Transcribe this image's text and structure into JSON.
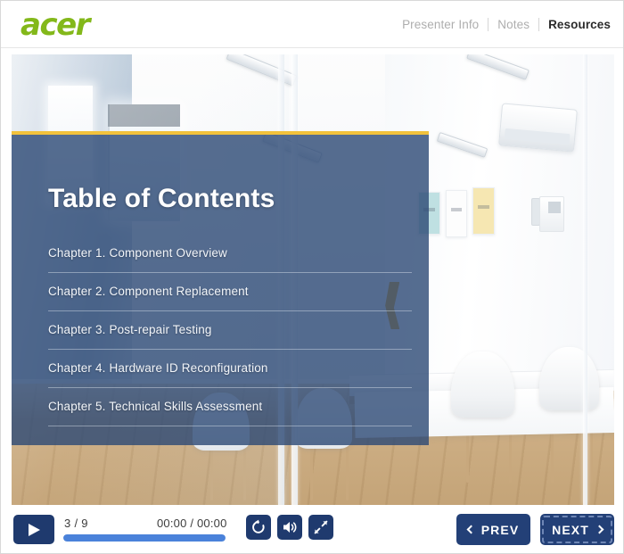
{
  "header": {
    "logo_text": "acer",
    "logo_color": "#83b81a",
    "nav": [
      {
        "label": "Presenter Info",
        "active": false
      },
      {
        "label": "Notes",
        "active": false
      },
      {
        "label": "Resources",
        "active": true
      }
    ]
  },
  "slide": {
    "title": "Table of Contents",
    "accent_bar_color": "#f2c23c",
    "panel_color": "#2c4874",
    "toc": [
      {
        "label": "Chapter 1. Component Overview"
      },
      {
        "label": "Chapter 2. Component Replacement"
      },
      {
        "label": "Chapter 3. Post-repair Testing"
      },
      {
        "label": "Chapter 4. Hardware ID Reconfiguration"
      },
      {
        "label": "Chapter 5. Technical Skills Assessment"
      }
    ]
  },
  "controls": {
    "play_label": "play-button",
    "slide_count": "3 / 9",
    "current_slide": 3,
    "total_slides": 9,
    "time_display": "00:00 / 00:00",
    "elapsed_time": "00:00",
    "total_time": "00:00",
    "progress_percent": 100,
    "progress_color": "#4a82da",
    "button_color": "#1f3a6e",
    "icons": [
      {
        "name": "replay-icon"
      },
      {
        "name": "volume-icon"
      },
      {
        "name": "fullscreen-icon"
      }
    ],
    "prev_label": "PREV",
    "next_label": "NEXT"
  }
}
